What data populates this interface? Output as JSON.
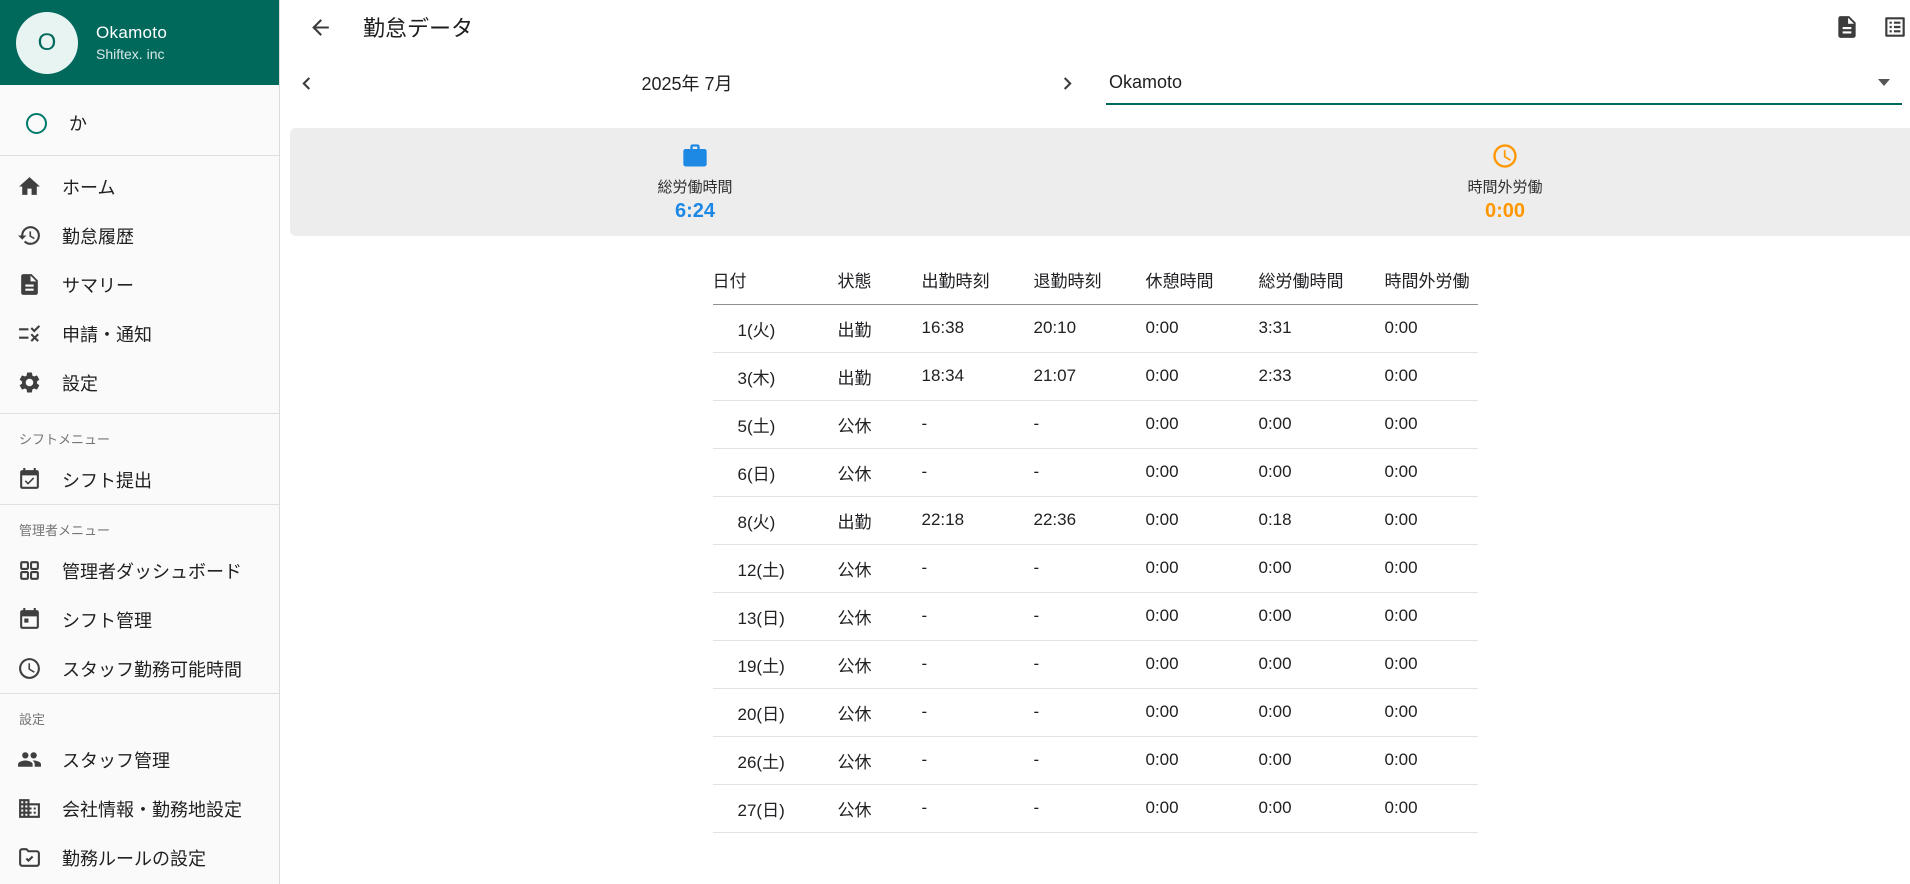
{
  "colors": {
    "primary_teal": "#00695C",
    "accent_blue": "#1E88E5",
    "accent_orange": "#FF9800"
  },
  "sidebar": {
    "profile": {
      "avatar_text": "O",
      "name": "Okamoto",
      "company": "Shiftex. inc"
    },
    "member": {
      "label": "か",
      "icon": "circle-outline-icon"
    },
    "menu": [
      {
        "label": "ホーム",
        "icon": "home-icon"
      },
      {
        "label": "勤怠履歴",
        "icon": "history-icon"
      },
      {
        "label": "サマリー",
        "icon": "summary-document-icon"
      },
      {
        "label": "申請・通知",
        "icon": "requests-rule-icon"
      },
      {
        "label": "設定",
        "icon": "settings-gear-icon"
      }
    ],
    "sections": [
      {
        "title": "シフトメニュー",
        "items": [
          {
            "label": "シフト提出",
            "icon": "calendar-check-icon"
          }
        ]
      },
      {
        "title": "管理者メニュー",
        "items": [
          {
            "label": "管理者ダッシュボード",
            "icon": "dashboard-grid-icon"
          },
          {
            "label": "シフト管理",
            "icon": "calendar-manage-icon"
          },
          {
            "label": "スタッフ勤務可能時間",
            "icon": "clock-icon"
          }
        ]
      },
      {
        "title": "設定",
        "items": [
          {
            "label": "スタッフ管理",
            "icon": "people-icon"
          },
          {
            "label": "会社情報・勤務地設定",
            "icon": "building-icon"
          },
          {
            "label": "勤務ルールの設定",
            "icon": "folder-rules-icon"
          }
        ]
      }
    ]
  },
  "header": {
    "title": "勤怠データ",
    "actions": [
      {
        "icon": "document-icon"
      },
      {
        "icon": "export-list-icon"
      }
    ]
  },
  "toolbar": {
    "month": "2025年 7月",
    "staff": "Okamoto"
  },
  "summary": {
    "total": {
      "label": "総労働時間",
      "value": "6:24",
      "color": "#1E88E5",
      "icon": "briefcase-icon"
    },
    "overtime": {
      "label": "時間外労働",
      "value": "0:00",
      "color": "#FF9800",
      "icon": "clock-icon"
    }
  },
  "table": {
    "headers": [
      "日付",
      "状態",
      "出勤時刻",
      "退勤時刻",
      "休憩時間",
      "総労働時間",
      "時間外労働"
    ],
    "rows": [
      {
        "date": "1(火)",
        "status": "出勤",
        "clock_in": "16:38",
        "clock_out": "20:10",
        "break_time": "0:00",
        "total": "3:31",
        "overtime": "0:00"
      },
      {
        "date": "3(木)",
        "status": "出勤",
        "clock_in": "18:34",
        "clock_out": "21:07",
        "break_time": "0:00",
        "total": "2:33",
        "overtime": "0:00"
      },
      {
        "date": "5(土)",
        "status": "公休",
        "clock_in": "-",
        "clock_out": "-",
        "break_time": "0:00",
        "total": "0:00",
        "overtime": "0:00"
      },
      {
        "date": "6(日)",
        "status": "公休",
        "clock_in": "-",
        "clock_out": "-",
        "break_time": "0:00",
        "total": "0:00",
        "overtime": "0:00"
      },
      {
        "date": "8(火)",
        "status": "出勤",
        "clock_in": "22:18",
        "clock_out": "22:36",
        "break_time": "0:00",
        "total": "0:18",
        "overtime": "0:00"
      },
      {
        "date": "12(土)",
        "status": "公休",
        "clock_in": "-",
        "clock_out": "-",
        "break_time": "0:00",
        "total": "0:00",
        "overtime": "0:00"
      },
      {
        "date": "13(日)",
        "status": "公休",
        "clock_in": "-",
        "clock_out": "-",
        "break_time": "0:00",
        "total": "0:00",
        "overtime": "0:00"
      },
      {
        "date": "19(土)",
        "status": "公休",
        "clock_in": "-",
        "clock_out": "-",
        "break_time": "0:00",
        "total": "0:00",
        "overtime": "0:00"
      },
      {
        "date": "20(日)",
        "status": "公休",
        "clock_in": "-",
        "clock_out": "-",
        "break_time": "0:00",
        "total": "0:00",
        "overtime": "0:00"
      },
      {
        "date": "26(土)",
        "status": "公休",
        "clock_in": "-",
        "clock_out": "-",
        "break_time": "0:00",
        "total": "0:00",
        "overtime": "0:00"
      },
      {
        "date": "27(日)",
        "status": "公休",
        "clock_in": "-",
        "clock_out": "-",
        "break_time": "0:00",
        "total": "0:00",
        "overtime": "0:00"
      }
    ]
  }
}
